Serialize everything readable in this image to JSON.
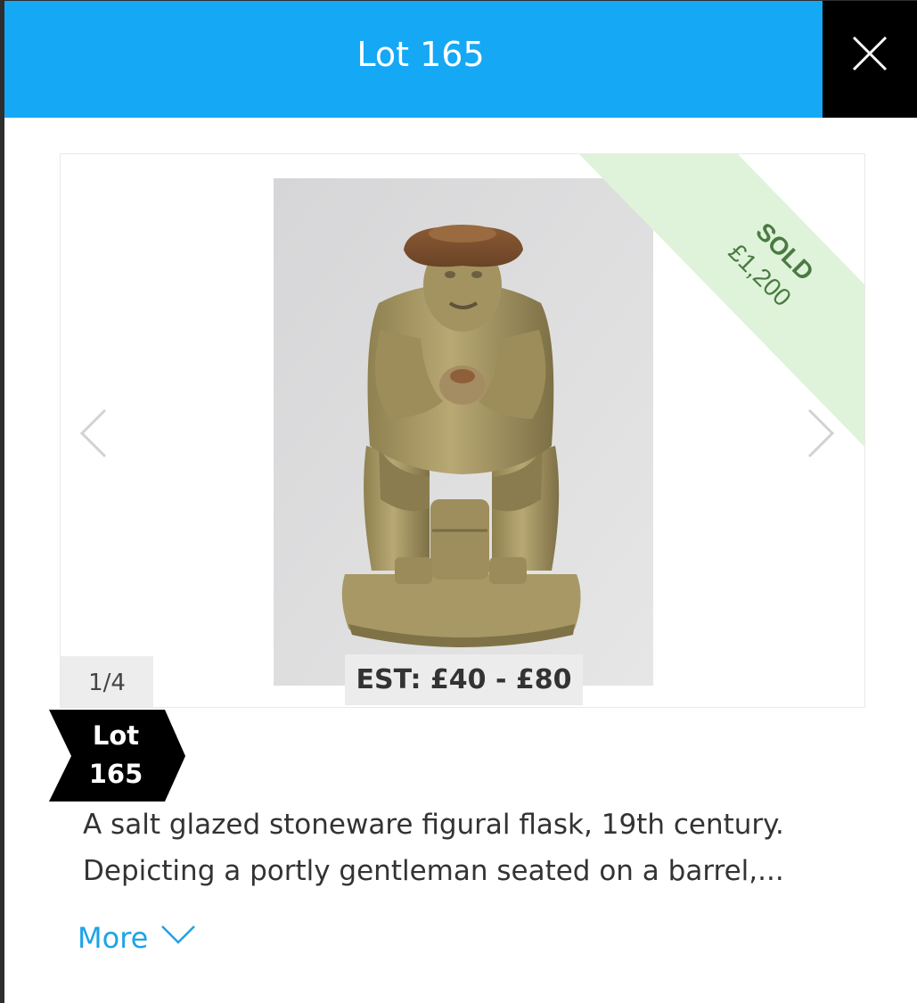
{
  "header": {
    "title": "Lot 165",
    "close_icon": "close-icon"
  },
  "gallery": {
    "counter": "1/4",
    "estimate": "EST: £40 - £80",
    "prev_icon": "chevron-left-icon",
    "next_icon": "chevron-right-icon",
    "image_subject": "stoneware-figure-flask"
  },
  "ribbon": {
    "status": "SOLD",
    "price": "£1,200",
    "color": "#dff3da",
    "text_color": "#4b7a43"
  },
  "lot_tag": {
    "line1": "Lot",
    "line2": "165"
  },
  "description": {
    "line1": "A salt glazed stoneware figural flask, 19th century.",
    "line2": "Depicting a portly gentleman seated on a barrel,..."
  },
  "more": {
    "label": "More",
    "icon": "chevron-down-icon"
  },
  "colors": {
    "header": "#15a8f5",
    "close": "#000000",
    "link": "#1ea3e8"
  }
}
